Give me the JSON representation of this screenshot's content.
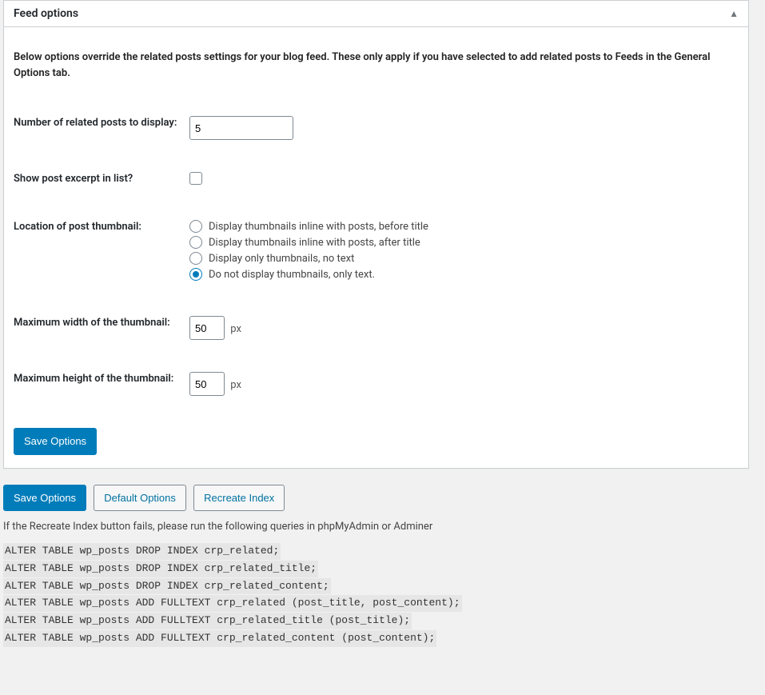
{
  "panel": {
    "title": "Feed options",
    "description": "Below options override the related posts settings for your blog feed. These only apply if you have selected to add related posts to Feeds in the General Options tab."
  },
  "fields": {
    "num_posts_label": "Number of related posts to display:",
    "num_posts_value": "5",
    "show_excerpt_label": "Show post excerpt in list?",
    "location_label": "Location of post thumbnail:",
    "location_options": [
      "Display thumbnails inline with posts, before title",
      "Display thumbnails inline with posts, after title",
      "Display only thumbnails, no text",
      "Do not display thumbnails, only text."
    ],
    "max_width_label": "Maximum width of the thumbnail:",
    "max_width_value": "50",
    "max_height_label": "Maximum height of the thumbnail:",
    "max_height_value": "50",
    "px": "px"
  },
  "buttons": {
    "save": "Save Options",
    "default": "Default Options",
    "recreate": "Recreate Index"
  },
  "footer_note": "If the Recreate Index button fails, please run the following queries in phpMyAdmin or Adminer",
  "sql": [
    "ALTER TABLE wp_posts DROP INDEX crp_related;",
    "ALTER TABLE wp_posts DROP INDEX crp_related_title;",
    "ALTER TABLE wp_posts DROP INDEX crp_related_content;",
    "ALTER TABLE wp_posts ADD FULLTEXT crp_related (post_title, post_content);",
    "ALTER TABLE wp_posts ADD FULLTEXT crp_related_title (post_title);",
    "ALTER TABLE wp_posts ADD FULLTEXT crp_related_content (post_content);"
  ]
}
